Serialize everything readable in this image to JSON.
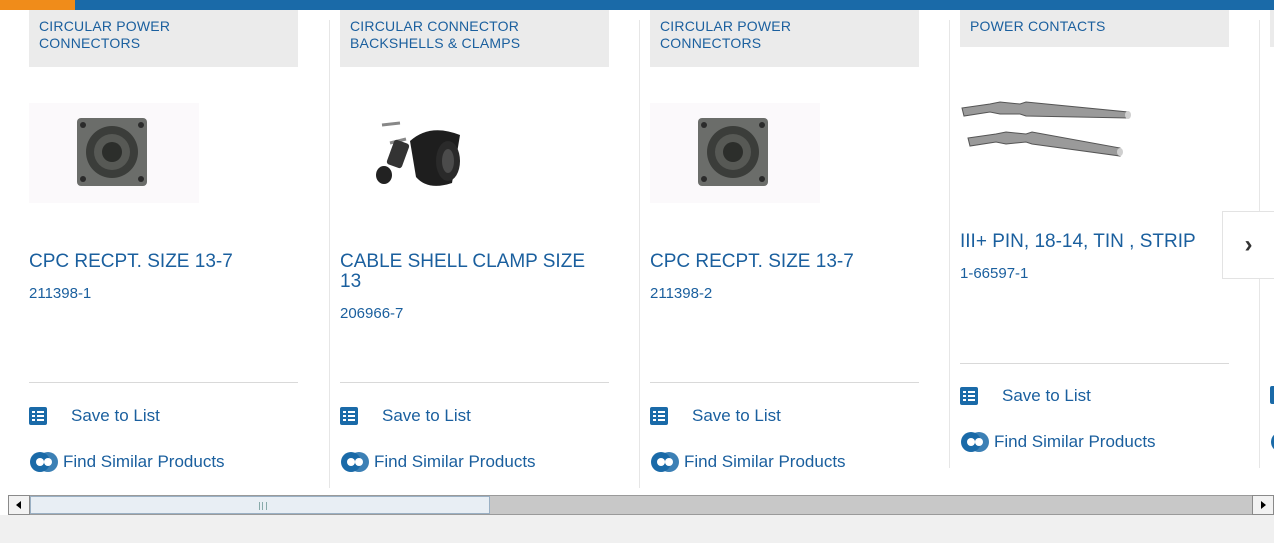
{
  "products": [
    {
      "category": "CIRCULAR POWER\nCONNECTORS",
      "title": "CPC RECPT. SIZE 13-7",
      "part_number": "211398-1",
      "image_icon": "circular-connector-image"
    },
    {
      "category": "CIRCULAR CONNECTOR\nBACKSHELLS & CLAMPS",
      "title": "CABLE SHELL CLAMP SIZE 13",
      "part_number": "206966-7",
      "image_icon": "cable-clamp-image"
    },
    {
      "category": "CIRCULAR POWER\nCONNECTORS",
      "title": "CPC RECPT. SIZE 13-7",
      "part_number": "211398-2",
      "image_icon": "circular-connector-image"
    },
    {
      "category": "POWER CONTACTS",
      "title": "III+ PIN, 18-14, TIN , STRIP",
      "part_number": "1-66597-1",
      "image_icon": "pin-contacts-image"
    }
  ],
  "actions": {
    "save_label": "Save to List",
    "similar_label": "Find Similar Products",
    "save_icon": "checklist-icon",
    "similar_icon": "find-similar-icon"
  },
  "navigation": {
    "next_label": "›",
    "next_icon": "chevron-right-icon"
  },
  "colors": {
    "brand_blue": "#1a6aa8",
    "link_blue": "#1a5f9e",
    "accent_orange": "#f08c1a",
    "category_bg": "#ebebeb"
  }
}
